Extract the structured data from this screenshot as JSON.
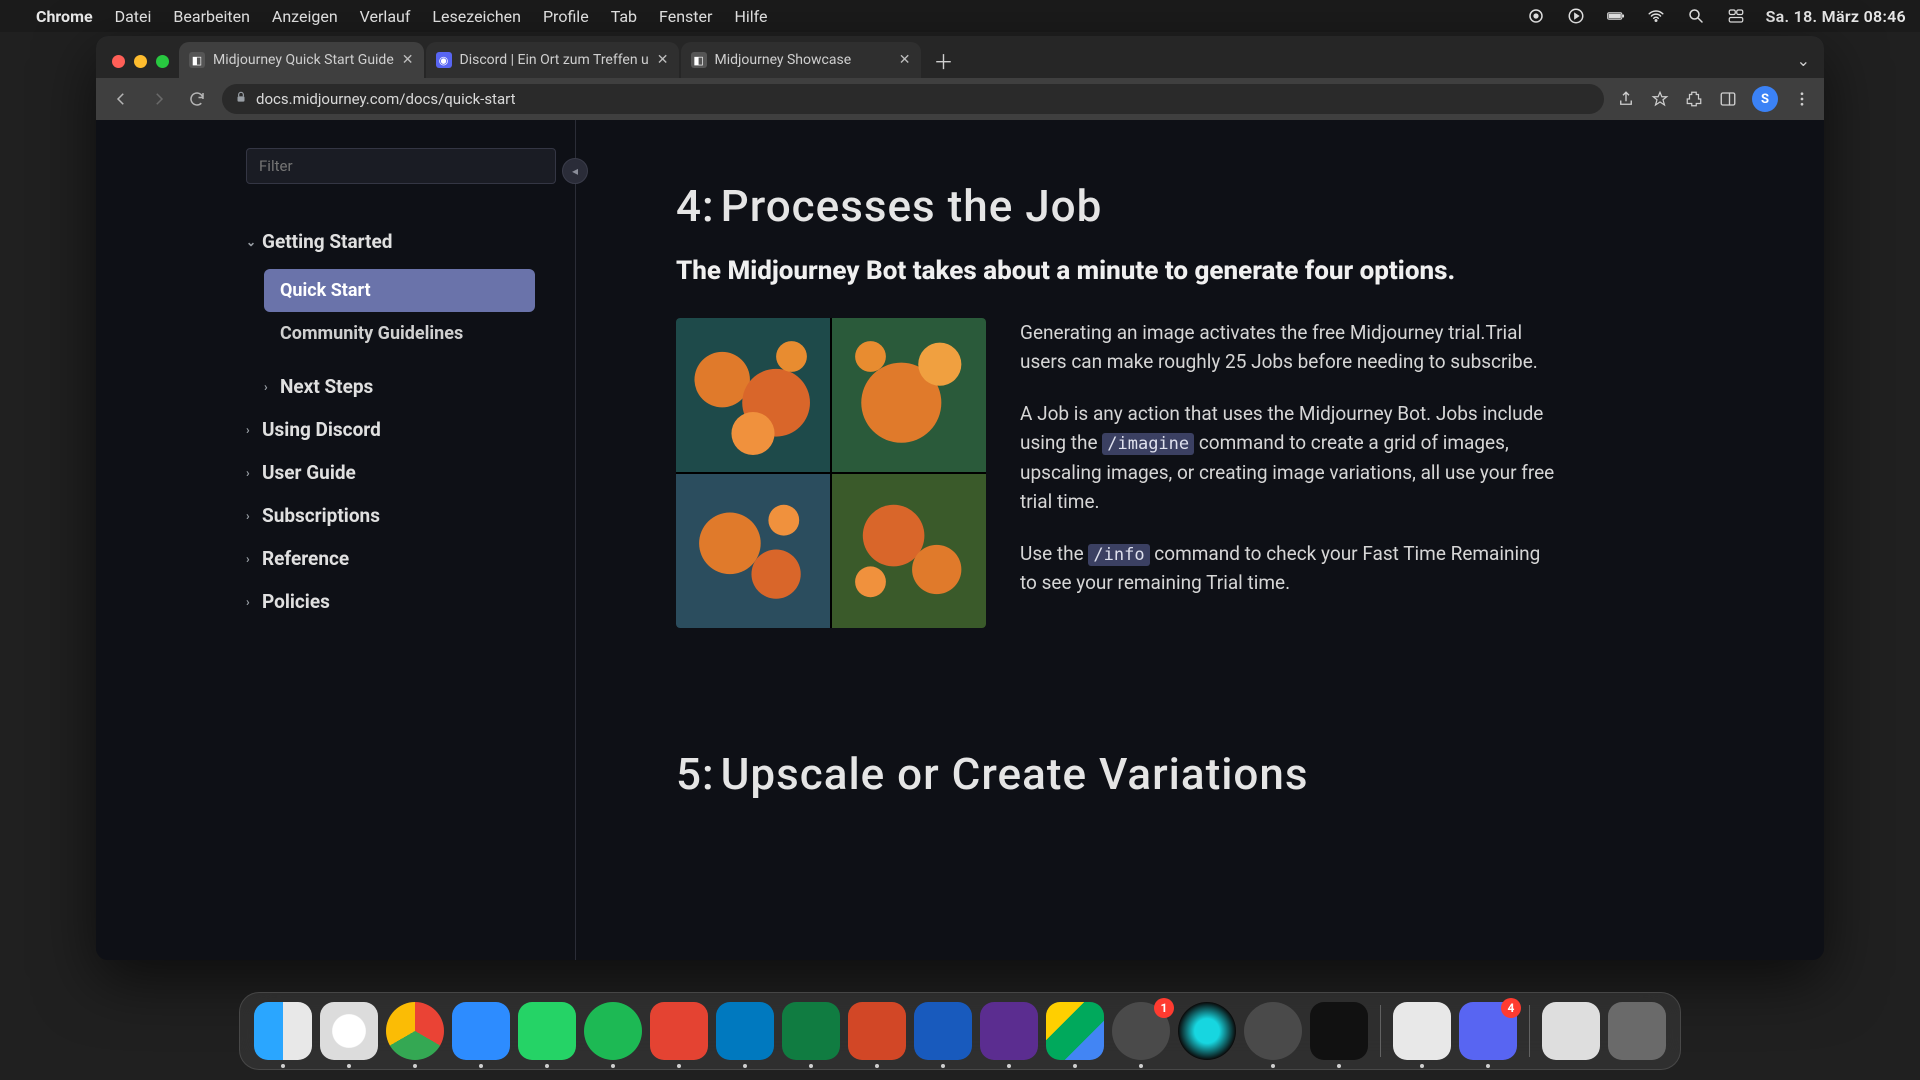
{
  "menubar": {
    "app": "Chrome",
    "menus": [
      "Datei",
      "Bearbeiten",
      "Anzeigen",
      "Verlauf",
      "Lesezeichen",
      "Profile",
      "Tab",
      "Fenster",
      "Hilfe"
    ],
    "clock": "Sa. 18. März  08:46"
  },
  "browser": {
    "tabs": [
      {
        "title": "Midjourney Quick Start Guide",
        "favicon": "M",
        "active": true
      },
      {
        "title": "Discord | Ein Ort zum Treffen u",
        "favicon": "D",
        "active": false
      },
      {
        "title": "Midjourney Showcase",
        "favicon": "M",
        "active": false
      }
    ],
    "url": "docs.midjourney.com/docs/quick-start",
    "avatar": "S"
  },
  "sidebar": {
    "filter_placeholder": "Filter",
    "sections": [
      {
        "label": "Getting Started",
        "expanded": true,
        "children": [
          {
            "label": "Quick Start",
            "active": true
          },
          {
            "label": "Community Guidelines",
            "active": false
          }
        ]
      },
      {
        "label": "Next Steps",
        "expanded": false
      },
      {
        "label": "Using Discord",
        "expanded": false
      },
      {
        "label": "User Guide",
        "expanded": false
      },
      {
        "label": "Subscriptions",
        "expanded": false
      },
      {
        "label": "Reference",
        "expanded": false
      },
      {
        "label": "Policies",
        "expanded": false
      }
    ]
  },
  "content": {
    "step4_num": "4:",
    "step4_title": "Processes the Job",
    "step4_sub": "The Midjourney Bot takes about a minute to generate four options.",
    "para1": "Generating an image activates the free Midjourney trial.Trial users can make roughly 25 Jobs before needing to subscribe.",
    "para2a": "A Job is any action that uses the Midjourney Bot. Jobs include using the ",
    "cmd_imagine": "/imagine",
    "para2b": " command to create a grid of images, upscaling images, or creating image variations, all use your free trial time.",
    "para3a": "Use the ",
    "cmd_info": "/info",
    "para3b": " command to check your Fast Time Remaining to see your remaining Trial time.",
    "step5_num": "5:",
    "step5_title": "Upscale or Create Variations"
  },
  "dock": {
    "items": [
      {
        "name": "finder",
        "running": true
      },
      {
        "name": "safari",
        "running": true
      },
      {
        "name": "chrome",
        "running": true
      },
      {
        "name": "zoom",
        "running": true
      },
      {
        "name": "whatsapp",
        "running": true
      },
      {
        "name": "spotify",
        "running": true
      },
      {
        "name": "todoist",
        "running": true
      },
      {
        "name": "trello",
        "running": true
      },
      {
        "name": "excel",
        "running": true
      },
      {
        "name": "powerpoint",
        "running": true
      },
      {
        "name": "word",
        "running": true
      },
      {
        "name": "imovie",
        "running": true
      },
      {
        "name": "drive",
        "running": true
      },
      {
        "name": "settings",
        "running": true,
        "badge": "1"
      },
      {
        "name": "siri",
        "running": false
      },
      {
        "name": "quicktime",
        "running": true
      },
      {
        "name": "voicememo",
        "running": true
      }
    ],
    "recent": [
      {
        "name": "preview",
        "running": true
      },
      {
        "name": "discord",
        "running": true,
        "badge": "4"
      }
    ],
    "pinned": [
      {
        "name": "downloads"
      },
      {
        "name": "trash"
      }
    ]
  }
}
